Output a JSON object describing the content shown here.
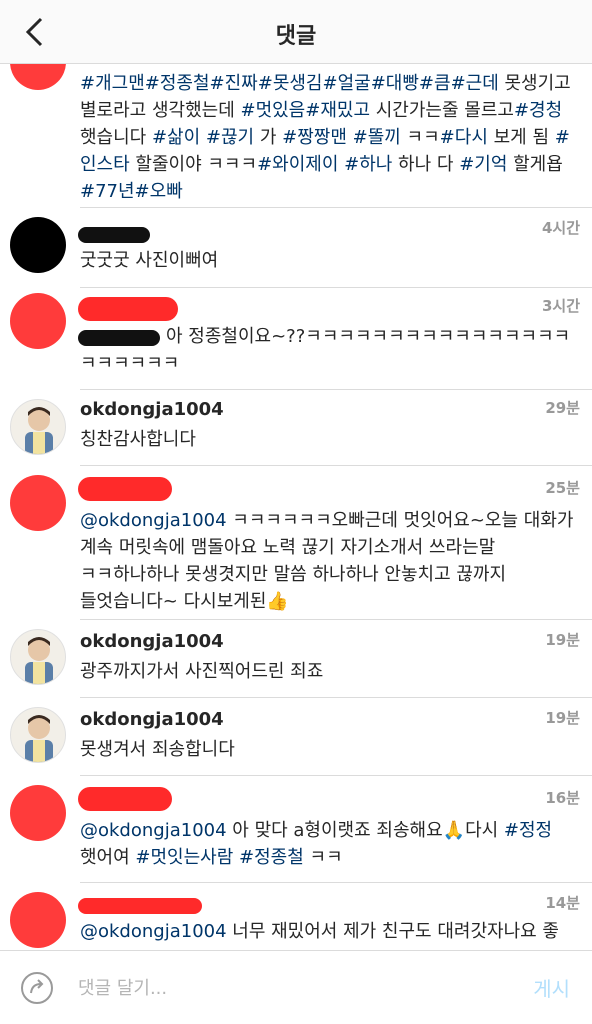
{
  "header": {
    "title": "댓글",
    "back_icon": "chevron-left-icon"
  },
  "comments": [
    {
      "body": [
        {
          "t": "#개그맨",
          "tag": true
        },
        {
          "t": "#정종철",
          "tag": true
        },
        {
          "t": "#진짜",
          "tag": true
        },
        {
          "t": "#못생김",
          "tag": true
        },
        {
          "t": "#얼굴",
          "tag": true
        },
        {
          "t": "#대빵",
          "tag": true
        },
        {
          "t": "#큼",
          "tag": true
        },
        {
          "t": "#근데",
          "tag": true
        },
        {
          "t": " 못생기고 별로라고 생각했는데 ",
          "tag": false
        },
        {
          "t": "#멋있음",
          "tag": true
        },
        {
          "t": "#재밌고",
          "tag": true
        },
        {
          "t": " 시간가는줄 몰르고",
          "tag": false
        },
        {
          "t": "#경청",
          "tag": true
        },
        {
          "t": " 햇습니다 ",
          "tag": false
        },
        {
          "t": "#삶이",
          "tag": true
        },
        {
          "t": " ",
          "tag": false
        },
        {
          "t": "#끊기",
          "tag": true
        },
        {
          "t": " 가 ",
          "tag": false
        },
        {
          "t": "#짱짱맨",
          "tag": true
        },
        {
          "t": " ",
          "tag": false
        },
        {
          "t": "#똘끼",
          "tag": true
        },
        {
          "t": " ㅋㅋ",
          "tag": false
        },
        {
          "t": "#다시",
          "tag": true
        },
        {
          "t": " 보게 됨 ",
          "tag": false
        },
        {
          "t": "#인스타",
          "tag": true
        },
        {
          "t": " 할줄이야 ㅋㅋㅋ",
          "tag": false
        },
        {
          "t": "#와이제이",
          "tag": true
        },
        {
          "t": " ",
          "tag": false
        },
        {
          "t": "#하나",
          "tag": true
        },
        {
          "t": " 하나 다 ",
          "tag": false
        },
        {
          "t": "#기억",
          "tag": true
        },
        {
          "t": " 할게욥 ",
          "tag": false
        },
        {
          "t": "#77년",
          "tag": true
        },
        {
          "t": "#오빠",
          "tag": true
        }
      ]
    },
    {
      "time": "4시간",
      "body": [
        {
          "t": "굿굿굿 사진이뻐여",
          "tag": false
        }
      ]
    },
    {
      "time": "3시간",
      "body": [
        {
          "t": "아 정종철이요~??ㅋㅋㅋㅋㅋㅋㅋㅋㅋㅋㅋㅋㅋㅋㅋㅋ ㅋㅋㅋㅋㅋㅋ",
          "tag": false
        }
      ]
    },
    {
      "username": "okdongja1004",
      "time": "29분",
      "body": [
        {
          "t": "칭찬감사합니다",
          "tag": false
        }
      ]
    },
    {
      "time": "25분",
      "body": [
        {
          "t": "@okdongja1004",
          "tag": true
        },
        {
          "t": " ㅋㅋㅋㅋㅋㅋ오빠근데 멋잇어요~오늘 대화가 계속 머릿속에 맴돌아요 노력 끊기 자기소개서 쓰라는말 ㅋㅋ하나하나 못생겻지만 말씀 하나하나 안놓치고 끊까지 들엇습니다~ 다시보게된👍",
          "tag": false
        }
      ]
    },
    {
      "username": "okdongja1004",
      "time": "19분",
      "body": [
        {
          "t": "광주까지가서 사진찍어드린 죄죠",
          "tag": false
        }
      ]
    },
    {
      "username": "okdongja1004",
      "time": "19분",
      "body": [
        {
          "t": "못생겨서 죄송합니다",
          "tag": false
        }
      ]
    },
    {
      "time": "16분",
      "body": [
        {
          "t": "@okdongja1004",
          "tag": true
        },
        {
          "t": " 아 맞다 a형이랫죠 죄송해요🙏",
          "tag": false
        },
        {
          "t": "다시 ",
          "tag": false
        },
        {
          "t": "#정정",
          "tag": true
        },
        {
          "t": " 햇어여 ",
          "tag": false
        },
        {
          "t": "#멋잇는사람",
          "tag": true
        },
        {
          "t": " ",
          "tag": false
        },
        {
          "t": "#정종철",
          "tag": true
        },
        {
          "t": " ㅋㅋ",
          "tag": false
        }
      ]
    },
    {
      "time": "14분",
      "body": [
        {
          "t": "@okdongja1004",
          "tag": true
        },
        {
          "t": " 너무 재밌어서 제가 친구도 대려갓자나요 좋",
          "tag": false
        }
      ]
    }
  ],
  "footer": {
    "placeholder": "댓글 달기...",
    "post_label": "게시",
    "share_icon": "share-arrow-icon"
  },
  "colors": {
    "link": "#003569",
    "accent_disabled": "#b2dffc",
    "redaction_red": "#ff2a2a"
  }
}
